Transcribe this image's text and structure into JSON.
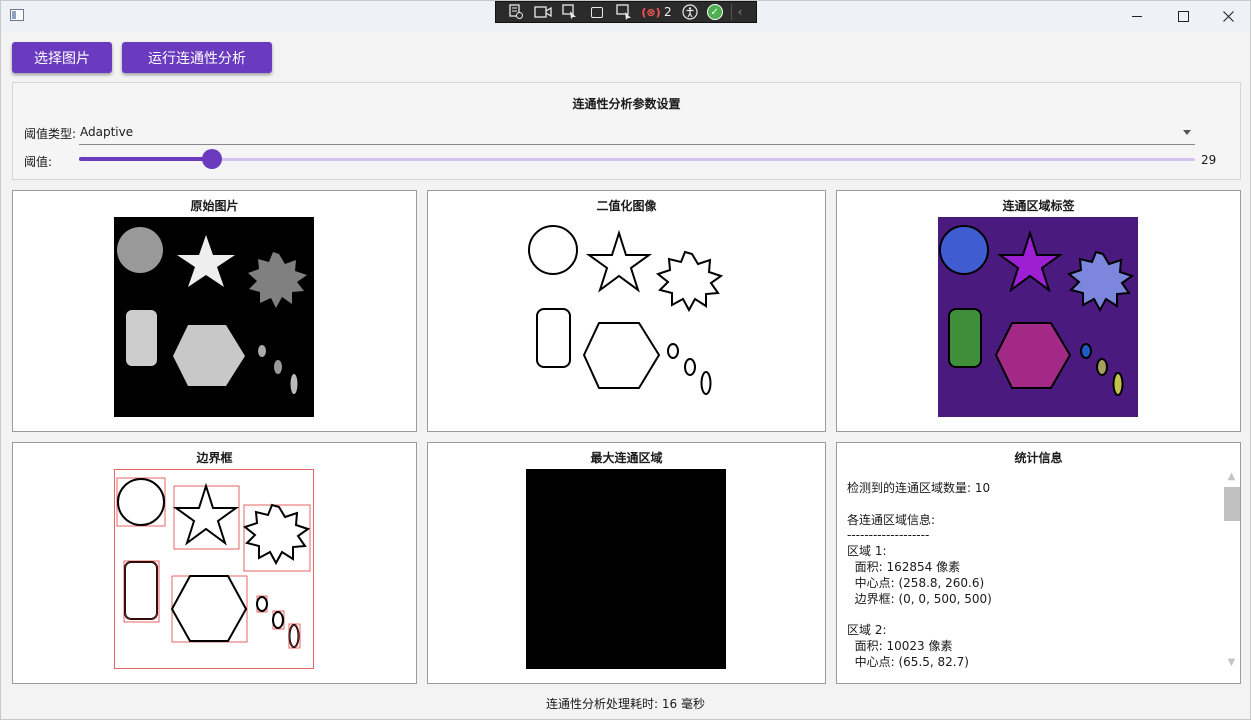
{
  "toolbar": {
    "select_image": "选择图片",
    "run_analysis": "运行连通性分析"
  },
  "debug_toolbar": {
    "binding_failures": "2"
  },
  "params": {
    "title": "连通性分析参数设置",
    "threshold_type_label": "阈值类型:",
    "threshold_type_value": "Adaptive",
    "threshold_label": "阈值:",
    "threshold_value": "29",
    "threshold_fraction": 0.119
  },
  "panels": {
    "original": "原始图片",
    "binary": "二值化图像",
    "labels": "连通区域标签",
    "bounding_box": "边界框",
    "largest": "最大连通区域",
    "stats": "统计信息"
  },
  "stats": {
    "text": "检测到的连通区域数量: 10\n\n各连通区域信息:\n-------------------\n区域 1:\n  面积: 162854 像素\n  中心点: (258.8, 260.6)\n  边界框: (0, 0, 500, 500)\n\n区域 2:\n  面积: 10023 像素\n  中心点: (65.5, 82.7)"
  },
  "footer": {
    "elapsed": "连通性分析处理耗时: 16 毫秒"
  },
  "colors": {
    "accent": "#6a3bbf",
    "accent_light": "#d3c3ee",
    "label_background": "#4b1a7e",
    "label_circle": "#3f5cd0",
    "label_star": "#9c1fd4",
    "label_burst": "#7b86dc",
    "label_rect": "#3f8f3a",
    "label_hexagon": "#a22a86",
    "label_small_1": "#1e5bc4",
    "label_small_2": "#a5a060",
    "label_small_3": "#c4c44a"
  }
}
